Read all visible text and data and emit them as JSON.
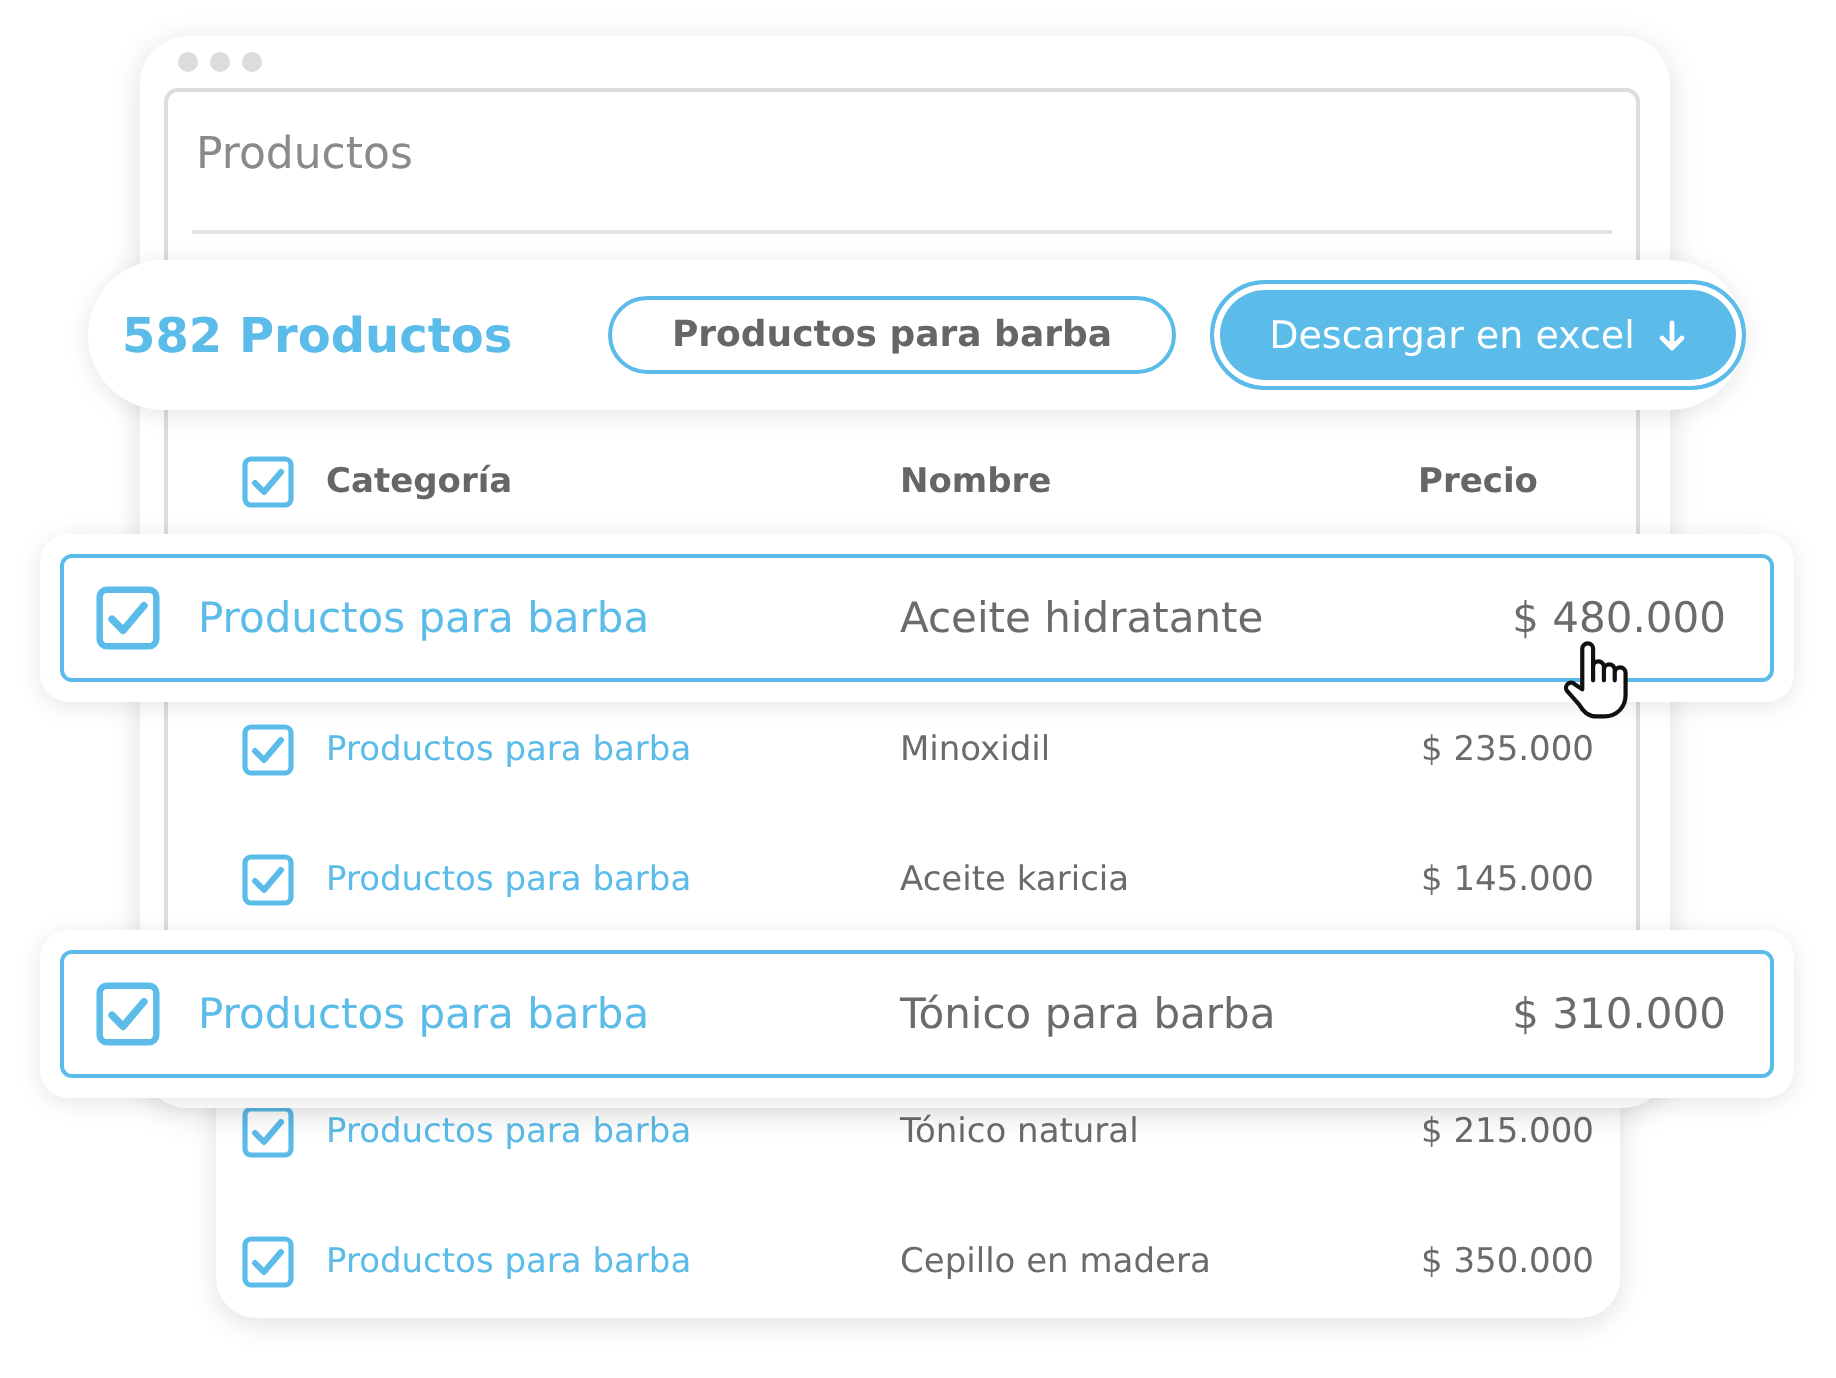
{
  "window": {
    "title": "Productos"
  },
  "toolbar": {
    "count": "582 Productos",
    "filter_chip": "Productos para barba",
    "download_button": "Descargar en excel"
  },
  "table": {
    "header_checked": true,
    "columns": [
      "Categoría",
      "Nombre",
      "Precio"
    ],
    "rows": [
      {
        "checked": true,
        "selected": true,
        "hovered": true,
        "category": "Productos para barba",
        "name": "Aceite hidratante",
        "price": "$ 480.000"
      },
      {
        "checked": true,
        "selected": false,
        "hovered": false,
        "category": "Productos para barba",
        "name": "Minoxidil",
        "price": "$ 235.000"
      },
      {
        "checked": true,
        "selected": false,
        "hovered": false,
        "category": "Productos para barba",
        "name": "Aceite karicia",
        "price": "$ 145.000"
      },
      {
        "checked": true,
        "selected": true,
        "hovered": false,
        "category": "Productos para barba",
        "name": "Tónico para barba",
        "price": "$ 310.000"
      },
      {
        "checked": true,
        "selected": false,
        "hovered": false,
        "category": "Productos para barba",
        "name": "Tónico natural",
        "price": "$ 215.000"
      },
      {
        "checked": true,
        "selected": false,
        "hovered": false,
        "category": "Productos para barba",
        "name": "Cepillo en madera",
        "price": "$ 350.000"
      }
    ]
  }
}
